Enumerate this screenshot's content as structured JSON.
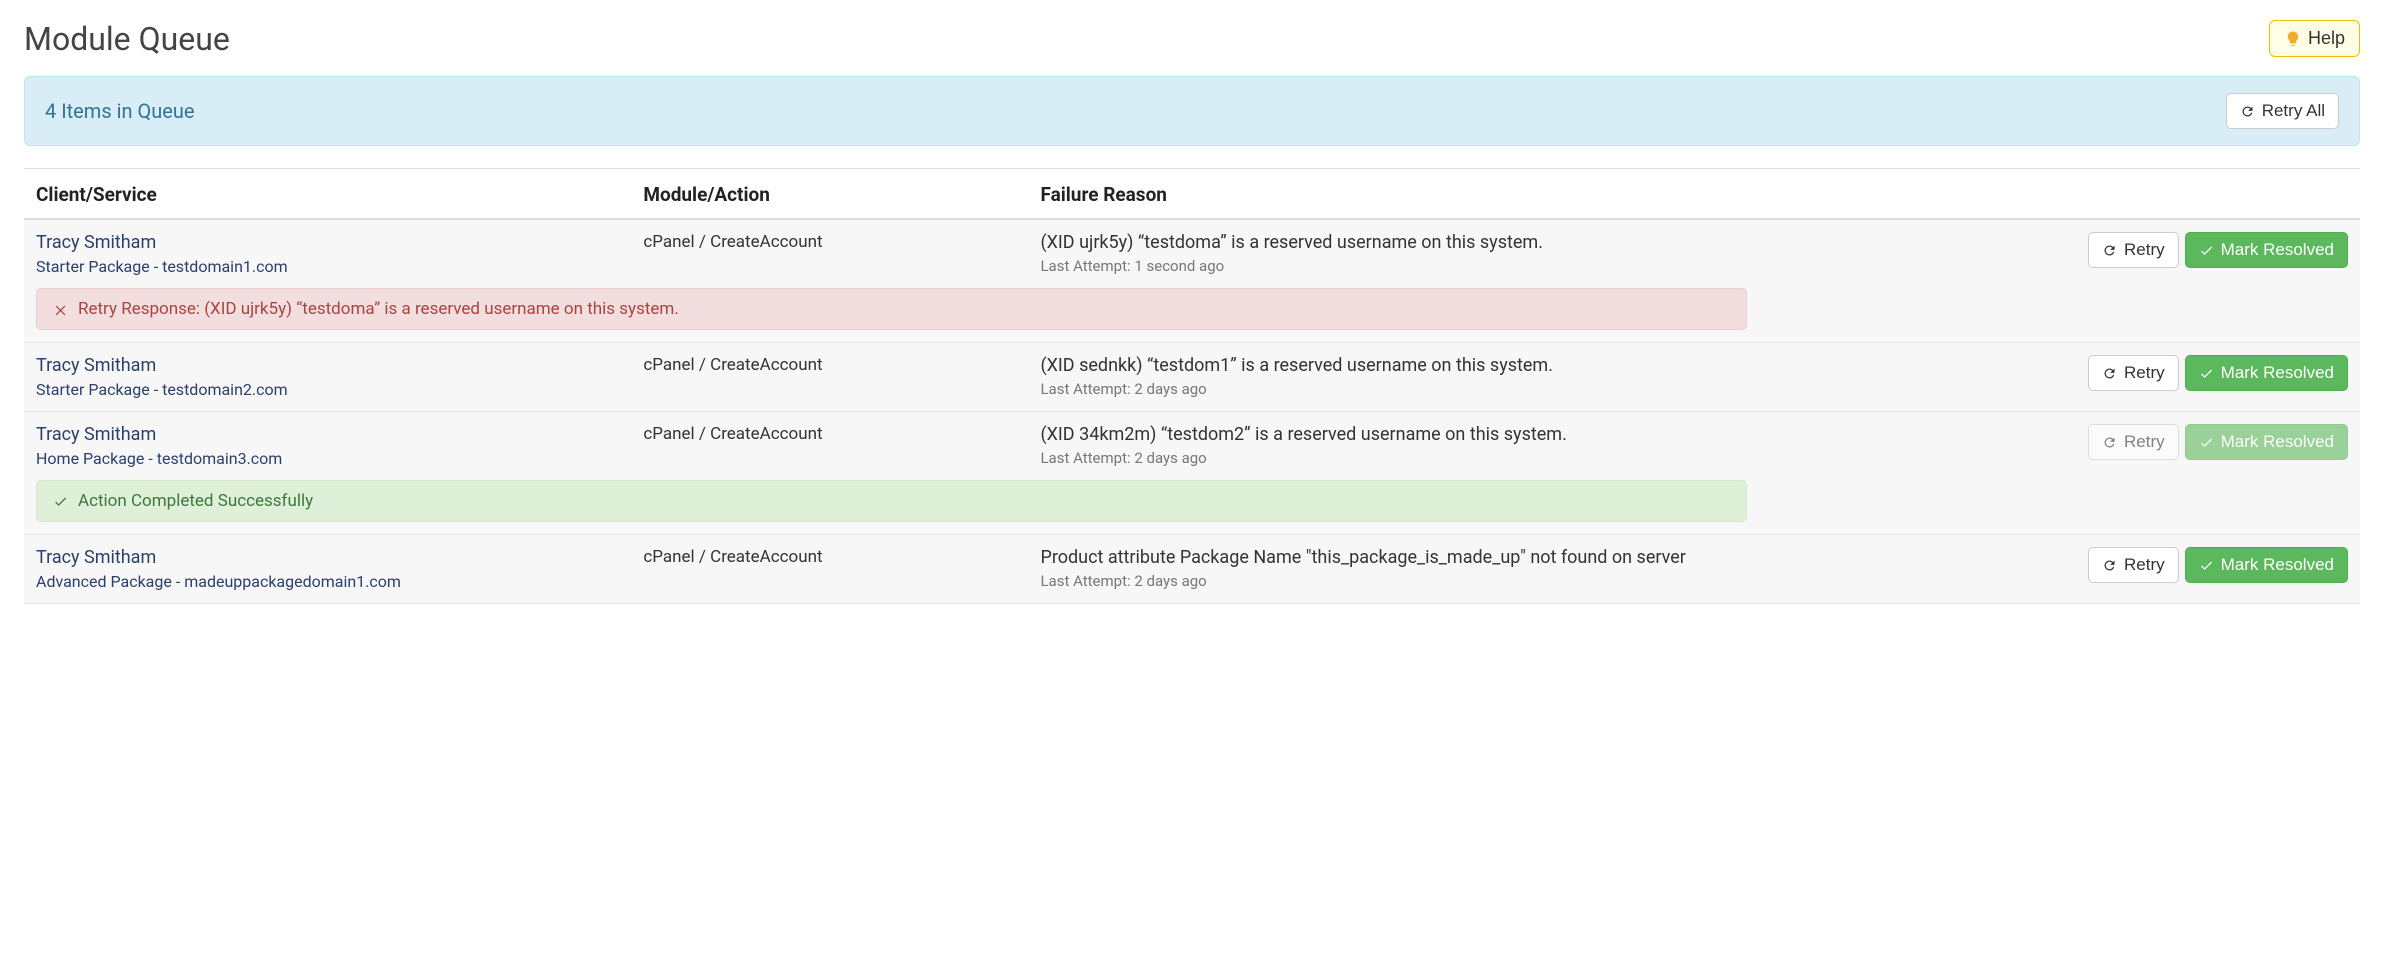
{
  "page_title": "Module Queue",
  "help_label": "Help",
  "queue": {
    "summary": "4 Items in Queue",
    "retry_all_label": "Retry All"
  },
  "columns": {
    "client": "Client/Service",
    "module": "Module/Action",
    "reason": "Failure Reason"
  },
  "labels": {
    "retry": "Retry",
    "mark_resolved": "Mark Resolved",
    "last_attempt_prefix": "Last Attempt: "
  },
  "rows": [
    {
      "client": "Tracy Smitham",
      "service": "Starter Package - testdomain1.com",
      "module_action": "cPanel / CreateAccount",
      "failure": "(XID ujrk5y) “testdoma” is a reserved username on this system.",
      "last_attempt": "1 second ago",
      "disabled": false,
      "message": {
        "type": "error",
        "text": "Retry Response: (XID ujrk5y) “testdoma” is a reserved username on this system."
      }
    },
    {
      "client": "Tracy Smitham",
      "service": "Starter Package - testdomain2.com",
      "module_action": "cPanel / CreateAccount",
      "failure": "(XID sednkk) “testdom1” is a reserved username on this system.",
      "last_attempt": "2 days ago",
      "disabled": false,
      "message": null
    },
    {
      "client": "Tracy Smitham",
      "service": "Home Package - testdomain3.com",
      "module_action": "cPanel / CreateAccount",
      "failure": "(XID 34km2m) “testdom2” is a reserved username on this system.",
      "last_attempt": "2 days ago",
      "disabled": true,
      "message": {
        "type": "success",
        "text": "Action Completed Successfully"
      }
    },
    {
      "client": "Tracy Smitham",
      "service": "Advanced Package - madeuppackagedomain1.com",
      "module_action": "cPanel / CreateAccount",
      "failure": "Product attribute Package Name \"this_package_is_made_up\" not found on server",
      "last_attempt": "2 days ago",
      "disabled": false,
      "message": null
    }
  ]
}
